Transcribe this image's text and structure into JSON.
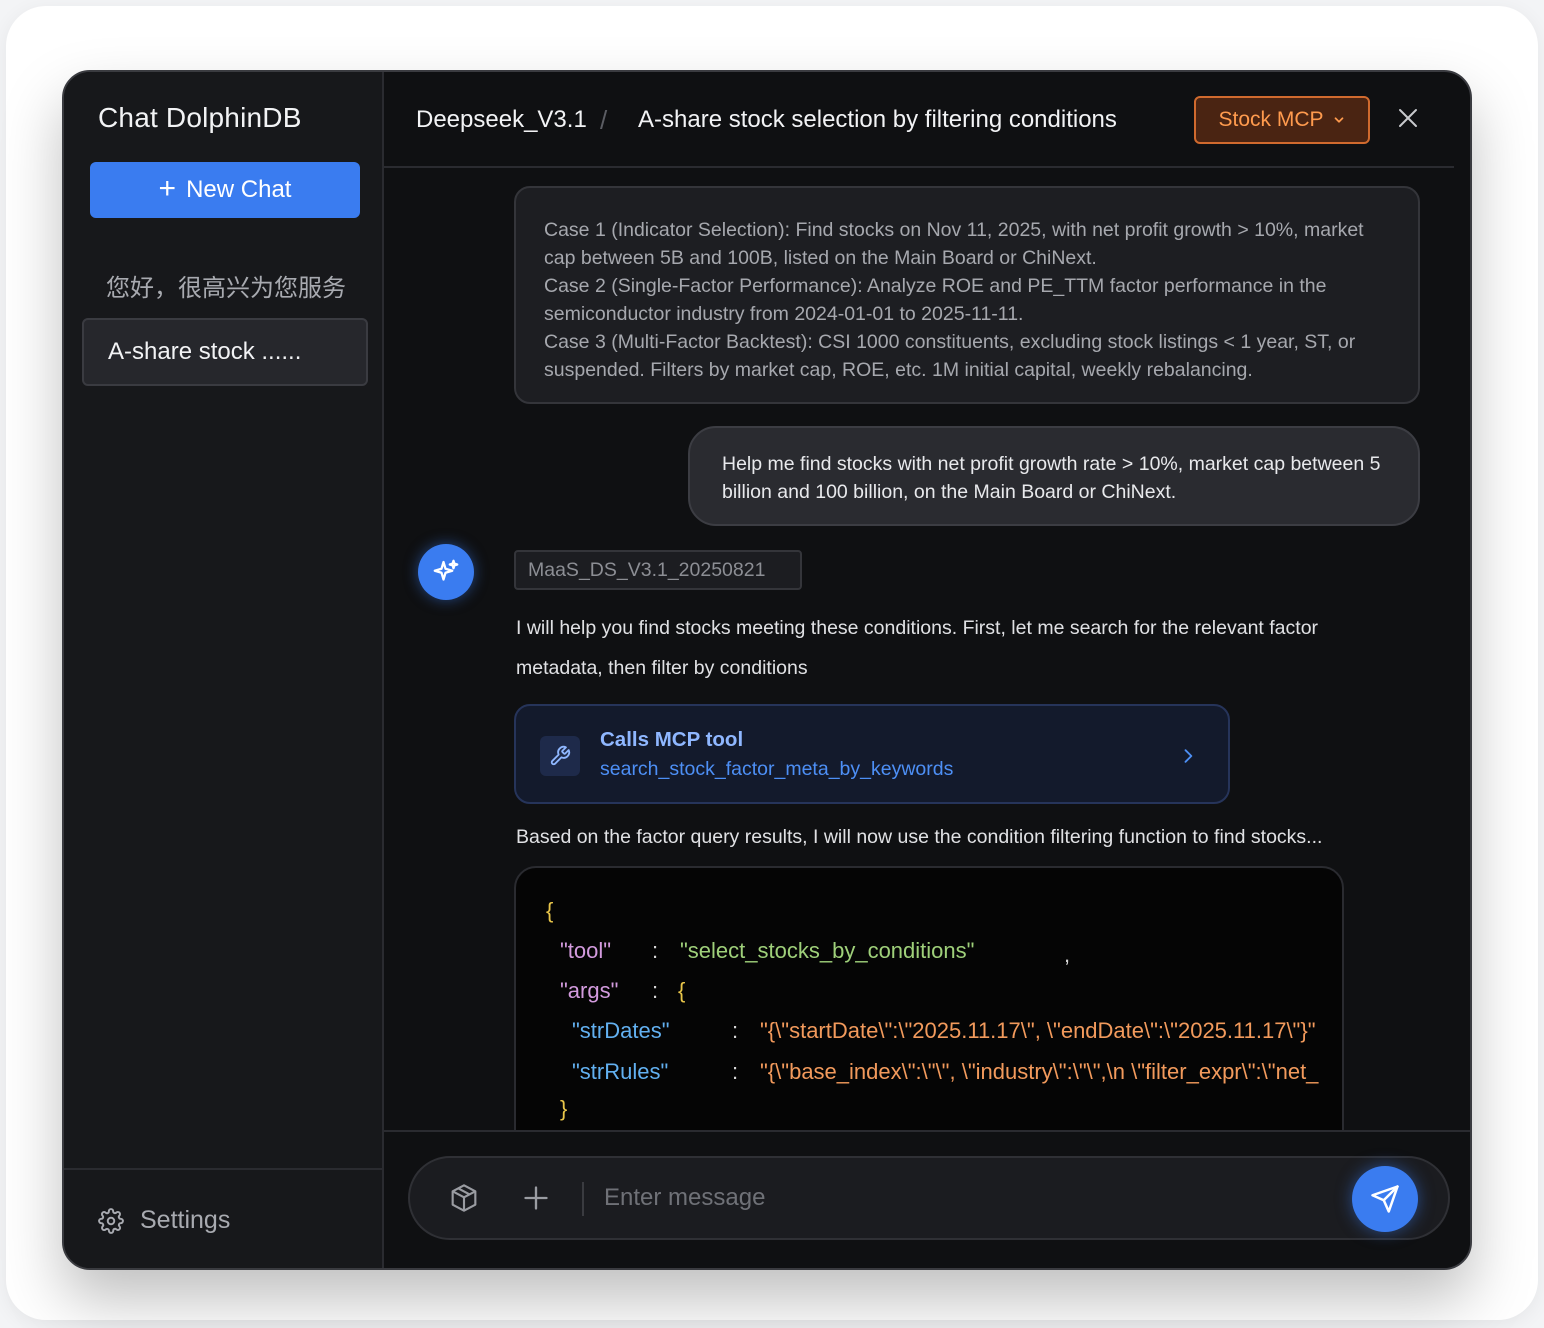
{
  "app": {
    "title": "Chat DolphinDB"
  },
  "sidebar": {
    "new_chat_label": "New Chat",
    "greeting": "您好，很高兴为您服务",
    "history": [
      {
        "label": "A-share stock ......"
      }
    ],
    "settings_label": "Settings"
  },
  "header": {
    "model": "Deepseek_V3.1",
    "separator": "/",
    "chat_title": "A-share stock selection by filtering conditions",
    "mcp_label": "Stock MCP"
  },
  "messages": {
    "examples": [
      "Case 1 (Indicator Selection): Find stocks on Nov 11, 2025, with net profit growth > 10%, market cap between 5B and 100B, listed on the Main Board or ChiNext.",
      "Case 2 (Single-Factor Performance): Analyze ROE and PE_TTM factor performance in the semiconductor industry from 2024-01-01 to 2025-11-11.",
      "Case 3 (Multi-Factor Backtest): CSI 1000 constituents, excluding stock listings < 1 year, ST, or suspended. Filters by market cap, ROE, etc. 1M initial capital, weekly rebalancing."
    ],
    "user_message": "Help me find stocks with net profit growth rate > 10%, market cap between 5 billion and 100 billion, on the Main Board or ChiNext.",
    "assistant": {
      "model_tag": "MaaS_DS_V3.1_20250821",
      "reply": "I will help you find stocks meeting these conditions. First, let me search for the relevant factor metadata, then filter by conditions",
      "tool_call": {
        "title": "Calls MCP tool",
        "name": "search_stock_factor_meta_by_keywords"
      },
      "followup": "Based on the factor query results, I will now use the condition filtering function to find stocks...",
      "code": {
        "open_brace": "{",
        "tool_key": "\"tool\"",
        "tool_value": "\"select_stocks_by_conditions\"",
        "args_key": "\"args\"",
        "args_open": "{",
        "dates_key": "\"strDates\"",
        "dates_value": "\"{\\\"startDate\\\":\\\"2025.11.17\\\", \\\"endDate\\\":\\\"2025.11.17\\\"}\"",
        "rules_key": "\"strRules\"",
        "rules_value": "\"{\\\"base_index\\\":\\\"\\\", \\\"industry\\\":\\\"\\\",\\n \\\"filter_expr\\\":\\\"net_",
        "args_close": "}",
        "colon": ":",
        "comma": ","
      }
    }
  },
  "input": {
    "placeholder": "Enter message"
  },
  "colors": {
    "accent": "#3a7cf0",
    "mcp_border": "#d06a2e",
    "mcp_text": "#ff9b4e"
  },
  "icons": [
    "plus-icon",
    "gear-icon",
    "chevron-down-icon",
    "close-icon",
    "sparkle-icon",
    "wrench-icon",
    "chevron-right-icon",
    "box-icon",
    "send-icon"
  ]
}
